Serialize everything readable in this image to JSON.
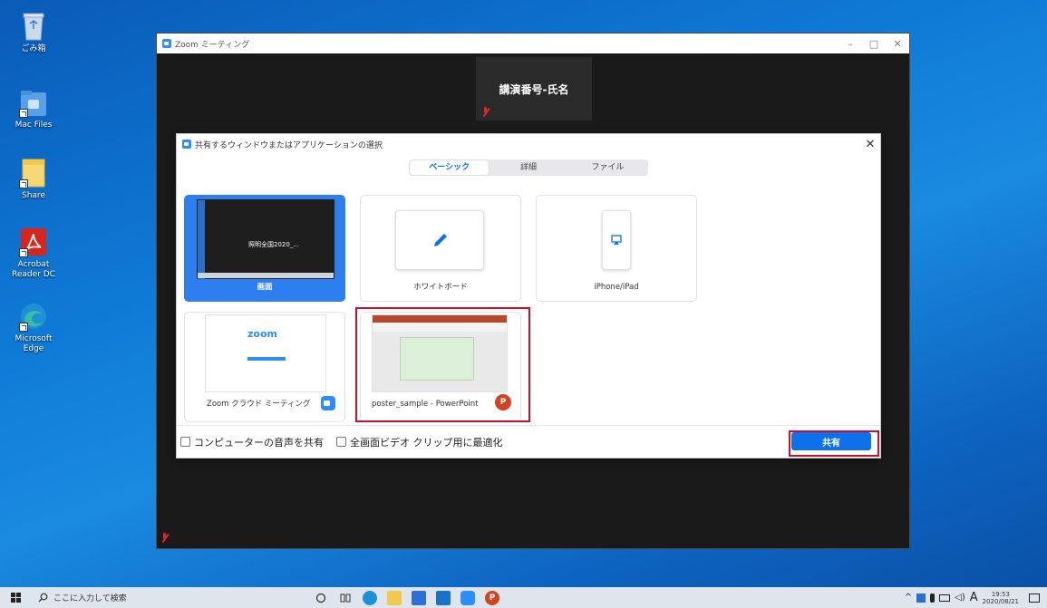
{
  "desktop": {
    "icons": [
      {
        "label": "ごみ箱",
        "icon": "recycle-bin-icon"
      },
      {
        "label": "Mac Files",
        "icon": "mac-files-folder-icon"
      },
      {
        "label": "Share",
        "icon": "share-folder-icon"
      },
      {
        "label": "Acrobat Reader DC",
        "icon": "acrobat-reader-icon"
      },
      {
        "label": "Microsoft Edge",
        "icon": "edge-icon"
      }
    ]
  },
  "zoom_window": {
    "title": "Zoom ミーティング",
    "participant_name": "講演番号-氏名",
    "controls": {
      "minimize": "–",
      "maximize": "□",
      "close": "✕"
    }
  },
  "share_dialog": {
    "title": "共有するウィンドウまたはアプリケーションの選択",
    "close": "✕",
    "tabs": [
      {
        "label": "ベーシック",
        "active": true
      },
      {
        "label": "詳細",
        "active": false
      },
      {
        "label": "ファイル",
        "active": false
      }
    ],
    "options": [
      {
        "label": "画面",
        "thumb_text": "照明全国2020_...",
        "selected": true
      },
      {
        "label": "ホワイトボード",
        "selected": false
      },
      {
        "label": "iPhone/iPad",
        "selected": false
      },
      {
        "label": "Zoom クラウド ミーティング",
        "thumb_text": "zoom",
        "selected": false
      },
      {
        "label": "poster_sample - PowerPoint",
        "selected": false,
        "highlighted": true
      }
    ],
    "footer": {
      "share_audio": "コンピューターの音声を共有",
      "optimize_video": "全画面ビデオ クリップ用に最適化",
      "share_button": "共有"
    }
  },
  "taskbar": {
    "search_placeholder": "ここに入力して検索",
    "ime_indicator": "A",
    "clock_time": "19:53",
    "clock_date": "2020/08/21"
  },
  "colors": {
    "zoom_blue": "#0e71eb",
    "selected_card": "#2d7ff0",
    "highlight_red": "#c8102e",
    "powerpoint_orange": "#d04423",
    "muted_red": "#e02828"
  }
}
